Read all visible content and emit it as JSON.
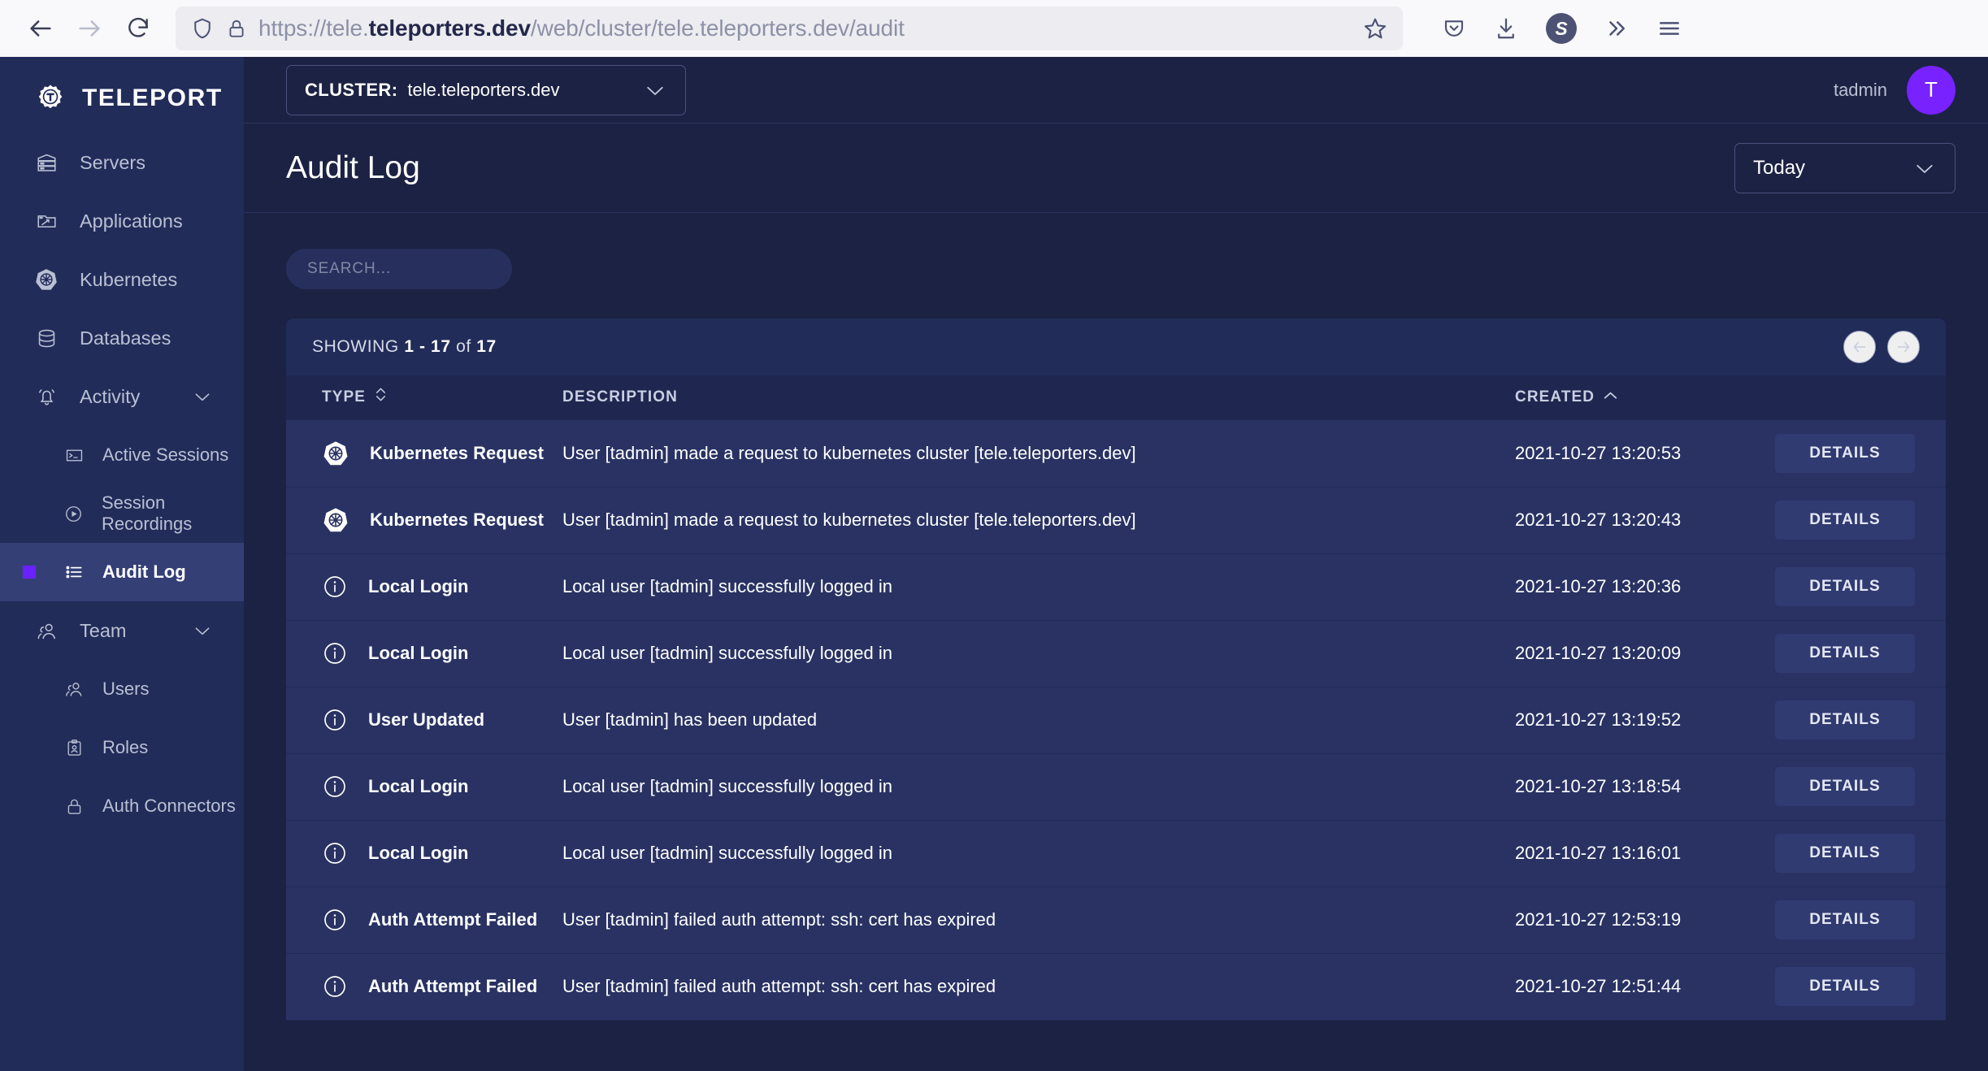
{
  "browser": {
    "back_label": "Back",
    "forward_label": "Forward",
    "reload_label": "Reload",
    "url_scheme": "https://tele.",
    "url_host": "teleporters.dev",
    "url_path": "/web/cluster/tele.teleporters.dev/audit",
    "url_full": "https://tele.teleporters.dev/web/cluster/tele.teleporters.dev/audit",
    "account_initial": "S",
    "icons": [
      "shield-icon",
      "lock-icon",
      "bookmark-star-icon",
      "pocket-icon",
      "downloads-icon",
      "account-icon",
      "overflow-icon",
      "menu-icon"
    ]
  },
  "sidebar": {
    "brand": "TELEPORT",
    "items": [
      {
        "label": "Servers",
        "icon": "server-icon",
        "level": "top"
      },
      {
        "label": "Applications",
        "icon": "application-window-icon",
        "level": "top"
      },
      {
        "label": "Kubernetes",
        "icon": "kubernetes-icon",
        "level": "top"
      },
      {
        "label": "Databases",
        "icon": "database-icon",
        "level": "top"
      },
      {
        "label": "Activity",
        "icon": "bell-icon",
        "level": "group",
        "expanded": true
      },
      {
        "label": "Active Sessions",
        "icon": "terminal-icon",
        "level": "sub"
      },
      {
        "label": "Session Recordings",
        "icon": "play-circle-icon",
        "level": "sub"
      },
      {
        "label": "Audit Log",
        "icon": "list-icon",
        "level": "sub",
        "active": true
      },
      {
        "label": "Team",
        "icon": "users-icon",
        "level": "group",
        "expanded": true
      },
      {
        "label": "Users",
        "icon": "users-icon",
        "level": "sub"
      },
      {
        "label": "Roles",
        "icon": "clipboard-user-icon",
        "level": "sub"
      },
      {
        "label": "Auth Connectors",
        "icon": "lock-icon",
        "level": "sub"
      }
    ]
  },
  "topbar": {
    "cluster_label": "CLUSTER:",
    "cluster_value": "tele.teleporters.dev",
    "username": "tadmin",
    "avatar_initial": "T"
  },
  "page": {
    "title": "Audit Log",
    "range_value": "Today"
  },
  "search": {
    "placeholder": "SEARCH...",
    "value": ""
  },
  "table": {
    "showing_prefix": "SHOWING",
    "showing_range": "1 - 17",
    "showing_of": "of",
    "showing_total": "17",
    "columns": [
      {
        "label": "TYPE",
        "sort": "none"
      },
      {
        "label": "DESCRIPTION",
        "sort": null
      },
      {
        "label": "CREATED",
        "sort": "asc"
      },
      {
        "label": "",
        "sort": null
      }
    ],
    "details_label": "DETAILS",
    "rows": [
      {
        "icon": "kubernetes-icon",
        "type": "Kubernetes Request",
        "description": "User [tadmin] made a request to kubernetes cluster [tele.teleporters.dev]",
        "created": "2021-10-27 13:20:53"
      },
      {
        "icon": "kubernetes-icon",
        "type": "Kubernetes Request",
        "description": "User [tadmin] made a request to kubernetes cluster [tele.teleporters.dev]",
        "created": "2021-10-27 13:20:43"
      },
      {
        "icon": "info-icon",
        "type": "Local Login",
        "description": "Local user [tadmin] successfully logged in",
        "created": "2021-10-27 13:20:36"
      },
      {
        "icon": "info-icon",
        "type": "Local Login",
        "description": "Local user [tadmin] successfully logged in",
        "created": "2021-10-27 13:20:09"
      },
      {
        "icon": "info-icon",
        "type": "User Updated",
        "description": "User [tadmin] has been updated",
        "created": "2021-10-27 13:19:52"
      },
      {
        "icon": "info-icon",
        "type": "Local Login",
        "description": "Local user [tadmin] successfully logged in",
        "created": "2021-10-27 13:18:54"
      },
      {
        "icon": "info-icon",
        "type": "Local Login",
        "description": "Local user [tadmin] successfully logged in",
        "created": "2021-10-27 13:16:01"
      },
      {
        "icon": "info-icon",
        "type": "Auth Attempt Failed",
        "description": "User [tadmin] failed auth attempt: ssh: cert has expired",
        "created": "2021-10-27 12:53:19"
      },
      {
        "icon": "info-icon",
        "type": "Auth Attempt Failed",
        "description": "User [tadmin] failed auth attempt: ssh: cert has expired",
        "created": "2021-10-27 12:51:44"
      }
    ]
  },
  "colors": {
    "accent": "#6b21ff",
    "avatar": "#7722ff",
    "sidebar_bg": "#222c59",
    "main_bg": "#1c2243",
    "row_bg": "#293263",
    "details_btn": "#303b72"
  }
}
